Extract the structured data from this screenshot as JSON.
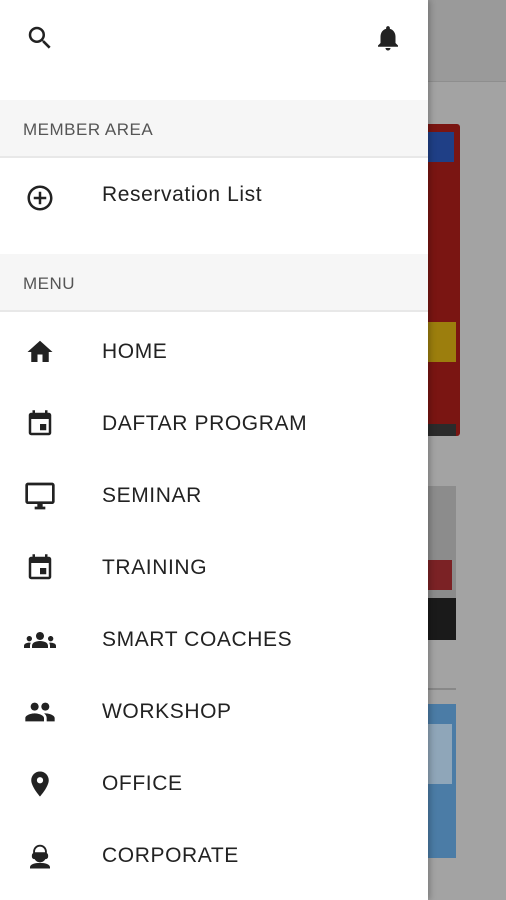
{
  "drawer": {
    "member_area": {
      "title": "MEMBER AREA",
      "items": [
        {
          "label": "Reservation List",
          "icon": "add-circle-icon"
        }
      ]
    },
    "menu": {
      "title": "MENU",
      "items": [
        {
          "label": "HOME",
          "icon": "home-icon"
        },
        {
          "label": "DAFTAR PROGRAM",
          "icon": "event-icon"
        },
        {
          "label": "SEMINAR",
          "icon": "desktop-icon"
        },
        {
          "label": "TRAINING",
          "icon": "event-icon"
        },
        {
          "label": "SMART COACHES",
          "icon": "group-icon"
        },
        {
          "label": "WORKSHOP",
          "icon": "people-icon"
        },
        {
          "label": "OFFICE",
          "icon": "location-pin-icon"
        },
        {
          "label": "CORPORATE",
          "icon": "person-headset-icon"
        }
      ]
    }
  },
  "colors": {
    "icon": "#222222",
    "header_bg": "#f6f6f6",
    "scrim": "#a3a3a3"
  }
}
